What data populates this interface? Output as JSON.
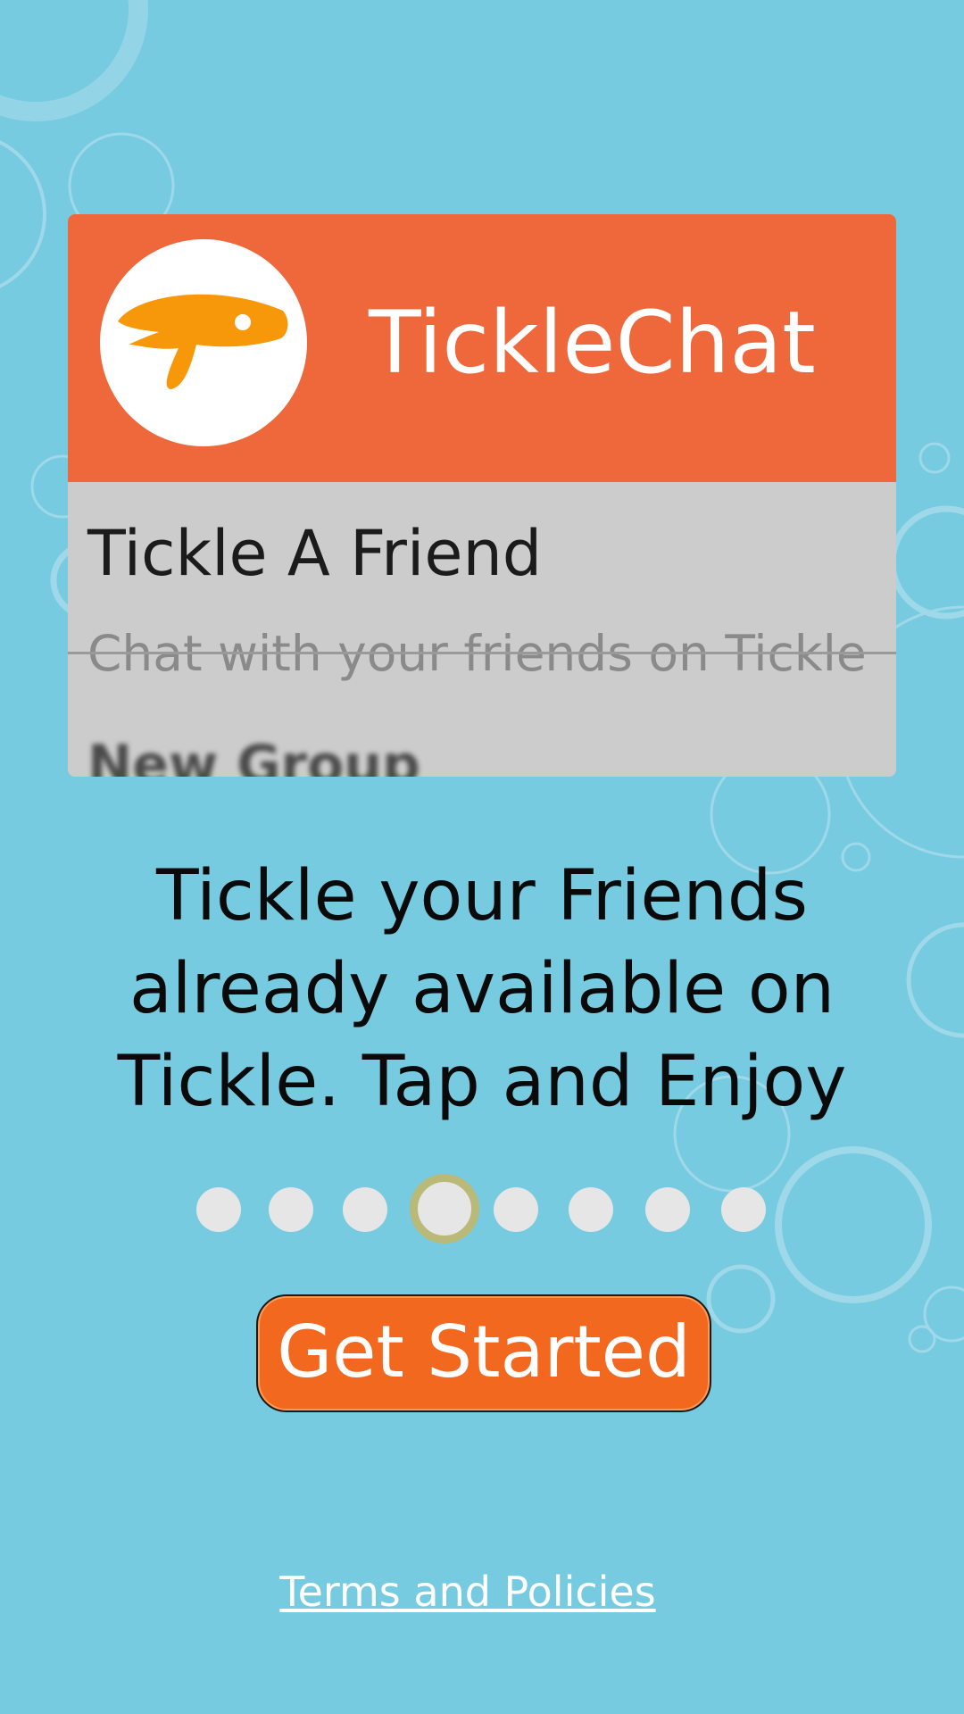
{
  "colors": {
    "background": "#76cbe0",
    "header_orange": "#ef683b",
    "button_orange": "#f2681e",
    "bubble": "#9fd8e8",
    "active_dot_ring": "#b9b978"
  },
  "preview": {
    "app_name": "TickleChat",
    "logo_icon": "speech-bubble-fish-logo",
    "item_title": "Tickle A Friend",
    "item_subtitle": "Chat with your friends on Tickle",
    "next_item_title": "New Group"
  },
  "tagline": "Tickle your Friends already available on Tickle. Tap and Enjoy",
  "pager": {
    "total": 8,
    "active_index": 3
  },
  "cta": {
    "label": "Get Started"
  },
  "footer": {
    "terms_label": "Terms and Policies"
  }
}
